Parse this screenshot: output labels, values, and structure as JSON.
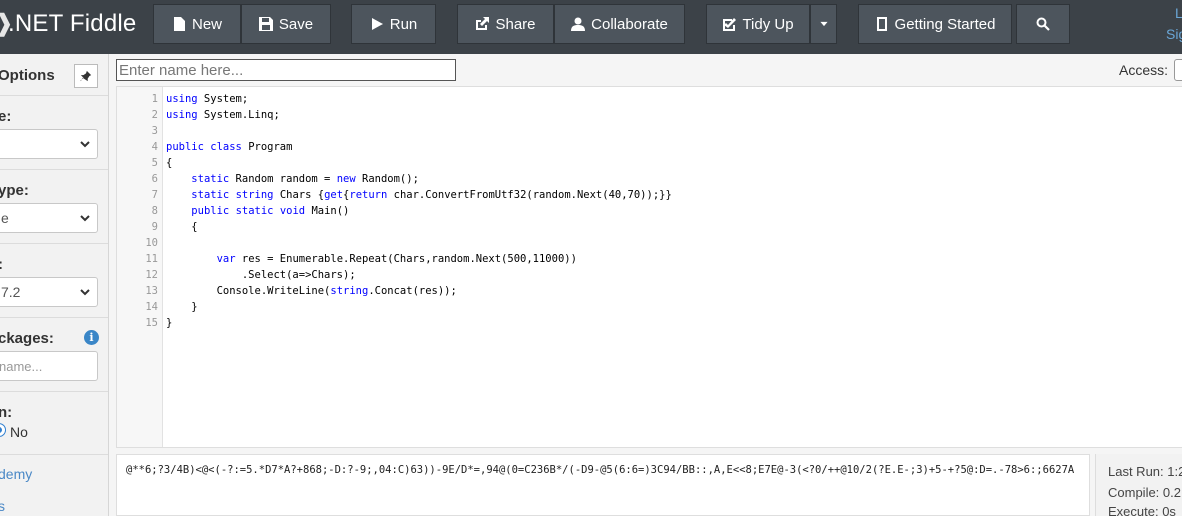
{
  "header": {
    "logo": ".NET Fiddle",
    "buttons": {
      "new": "New",
      "save": "Save",
      "run": "Run",
      "share": "Share",
      "collaborate": "Collaborate",
      "tidy": "Tidy Up",
      "getting_started": "Getting Started"
    },
    "login": "L",
    "signup": "Sig"
  },
  "sidebar": {
    "title": "Options",
    "language_label": "e:",
    "project_type_label": "ype:",
    "project_type_value": "e",
    "compiler_label": ":",
    "compiler_value": "7.2",
    "packages_label": "ckages:",
    "packages_placeholder": "name...",
    "auto_run_label": "n:",
    "auto_run_value": "No",
    "academy_link": "demy",
    "s_link": "s"
  },
  "main": {
    "name_placeholder": "Enter name here...",
    "access_label": "Access:",
    "code_lines": [
      {
        "n": "1",
        "text": "using System;"
      },
      {
        "n": "2",
        "text": "using System.Linq;"
      },
      {
        "n": "3",
        "text": ""
      },
      {
        "n": "4",
        "text": "public class Program"
      },
      {
        "n": "5",
        "text": "{"
      },
      {
        "n": "6",
        "text": "    static Random random = new Random();"
      },
      {
        "n": "7",
        "text": "    static string Chars {get{return char.ConvertFromUtf32(random.Next(40,70));}}"
      },
      {
        "n": "8",
        "text": "    public static void Main()"
      },
      {
        "n": "9",
        "text": "    {"
      },
      {
        "n": "10",
        "text": ""
      },
      {
        "n": "11",
        "text": "        var res = Enumerable.Repeat(Chars,random.Next(500,11000))"
      },
      {
        "n": "12",
        "text": "            .Select(a=>Chars);"
      },
      {
        "n": "13",
        "text": "        Console.WriteLine(string.Concat(res));"
      },
      {
        "n": "14",
        "text": "    }"
      },
      {
        "n": "15",
        "text": "}"
      }
    ],
    "output": "@**6;?3/4B)<@<(-?:=5.*D7*A?+868;-D:?-9;,04:C)63))-9E/D*=,94@(0=C236B*/(-D9-@5(6:6=)3C94/BB::,A,E<<8;E7E@-3(<?0/++@10/2(?E.E-;3)+5-+?5@:D=.-78>6:;6627A"
  },
  "stats": {
    "last_run": "Last Run: 1:2",
    "compile": "Compile:  0.2",
    "execute": "Execute:  0s"
  }
}
